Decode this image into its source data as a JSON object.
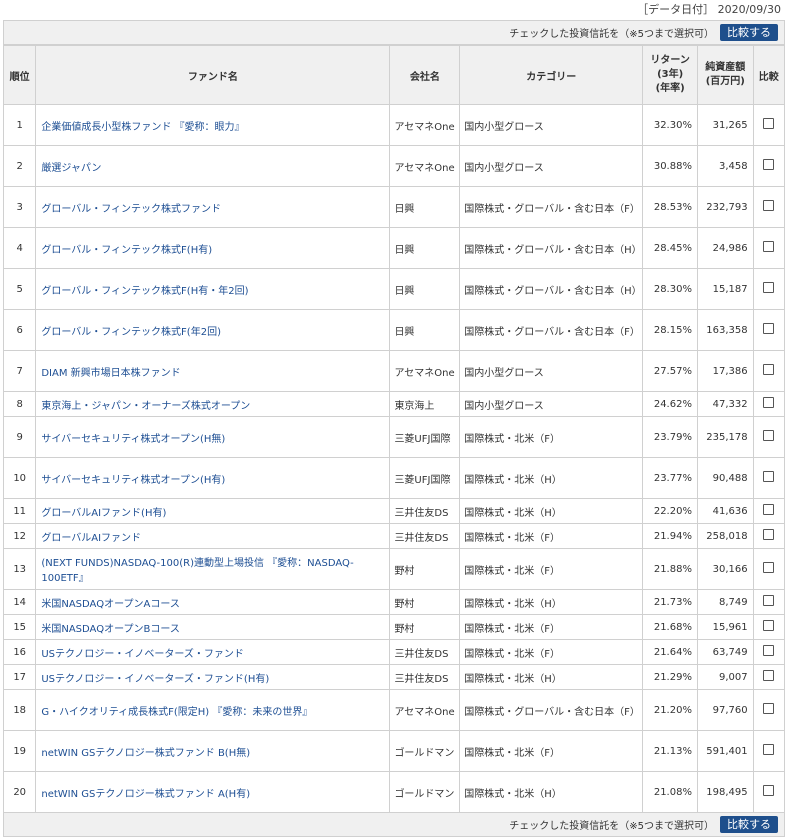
{
  "date_label": "［データ日付］ 2020/09/30",
  "compare": {
    "hint": "チェックした投資信託を（※5つまで選択可）",
    "button": "比較する"
  },
  "headers": {
    "rank": "順位",
    "fund": "ファンド名",
    "company": "会社名",
    "category": "カテゴリー",
    "return": "リターン\n(3年)\n(年率)",
    "assets": "純資産額\n(百万円)",
    "compare": "比較"
  },
  "rows": [
    {
      "rank": "1",
      "fund": "企業価値成長小型株ファンド 『愛称：眼力』",
      "company": "アセマネOne",
      "category": "国内小型グロース",
      "ret": "32.30%",
      "assets": "31,265"
    },
    {
      "rank": "2",
      "fund": "厳選ジャパン",
      "company": "アセマネOne",
      "category": "国内小型グロース",
      "ret": "30.88%",
      "assets": "3,458"
    },
    {
      "rank": "3",
      "fund": "グローバル・フィンテック株式ファンド",
      "company": "日興",
      "category": "国際株式・グローバル・含む日本（F）",
      "ret": "28.53%",
      "assets": "232,793"
    },
    {
      "rank": "4",
      "fund": "グローバル・フィンテック株式F(H有)",
      "company": "日興",
      "category": "国際株式・グローバル・含む日本（H）",
      "ret": "28.45%",
      "assets": "24,986"
    },
    {
      "rank": "5",
      "fund": "グローバル・フィンテック株式F(H有・年2回)",
      "company": "日興",
      "category": "国際株式・グローバル・含む日本（H）",
      "ret": "28.30%",
      "assets": "15,187"
    },
    {
      "rank": "6",
      "fund": "グローバル・フィンテック株式F(年2回)",
      "company": "日興",
      "category": "国際株式・グローバル・含む日本（F）",
      "ret": "28.15%",
      "assets": "163,358"
    },
    {
      "rank": "7",
      "fund": "DIAM 新興市場日本株ファンド",
      "company": "アセマネOne",
      "category": "国内小型グロース",
      "ret": "27.57%",
      "assets": "17,386"
    },
    {
      "rank": "8",
      "fund": "東京海上・ジャパン・オーナーズ株式オープン",
      "company": "東京海上",
      "category": "国内小型グロース",
      "ret": "24.62%",
      "assets": "47,332"
    },
    {
      "rank": "9",
      "fund": "サイバーセキュリティ株式オープン(H無)",
      "company": "三菱UFJ国際",
      "category": "国際株式・北米（F）",
      "ret": "23.79%",
      "assets": "235,178"
    },
    {
      "rank": "10",
      "fund": "サイバーセキュリティ株式オープン(H有)",
      "company": "三菱UFJ国際",
      "category": "国際株式・北米（H）",
      "ret": "23.77%",
      "assets": "90,488"
    },
    {
      "rank": "11",
      "fund": "グローバルAIファンド(H有)",
      "company": "三井住友DS",
      "category": "国際株式・北米（H）",
      "ret": "22.20%",
      "assets": "41,636"
    },
    {
      "rank": "12",
      "fund": "グローバルAIファンド",
      "company": "三井住友DS",
      "category": "国際株式・北米（F）",
      "ret": "21.94%",
      "assets": "258,018"
    },
    {
      "rank": "13",
      "fund": "(NEXT FUNDS)NASDAQ-100(R)連動型上場投信 『愛称：NASDAQ-100ETF』",
      "company": "野村",
      "category": "国際株式・北米（F）",
      "ret": "21.88%",
      "assets": "30,166"
    },
    {
      "rank": "14",
      "fund": "米国NASDAQオープンAコース",
      "company": "野村",
      "category": "国際株式・北米（H）",
      "ret": "21.73%",
      "assets": "8,749"
    },
    {
      "rank": "15",
      "fund": "米国NASDAQオープンBコース",
      "company": "野村",
      "category": "国際株式・北米（F）",
      "ret": "21.68%",
      "assets": "15,961"
    },
    {
      "rank": "16",
      "fund": "USテクノロジー・イノベーターズ・ファンド",
      "company": "三井住友DS",
      "category": "国際株式・北米（F）",
      "ret": "21.64%",
      "assets": "63,749"
    },
    {
      "rank": "17",
      "fund": "USテクノロジー・イノベーターズ・ファンド(H有)",
      "company": "三井住友DS",
      "category": "国際株式・北米（H）",
      "ret": "21.29%",
      "assets": "9,007"
    },
    {
      "rank": "18",
      "fund": "G・ハイクオリティ成長株式F(限定H) 『愛称：未来の世界』",
      "company": "アセマネOne",
      "category": "国際株式・グローバル・含む日本（F）",
      "ret": "21.20%",
      "assets": "97,760"
    },
    {
      "rank": "19",
      "fund": "netWIN GSテクノロジー株式ファンド B(H無)",
      "company": "ゴールドマン",
      "category": "国際株式・北米（F）",
      "ret": "21.13%",
      "assets": "591,401"
    },
    {
      "rank": "20",
      "fund": "netWIN GSテクノロジー株式ファンド A(H有)",
      "company": "ゴールドマン",
      "category": "国際株式・北米（H）",
      "ret": "21.08%",
      "assets": "198,495"
    }
  ],
  "row_heights": [
    41,
    41,
    41,
    41,
    41,
    41,
    41,
    25,
    41,
    41,
    25,
    25,
    41,
    25,
    25,
    25,
    25,
    41,
    41,
    41
  ]
}
